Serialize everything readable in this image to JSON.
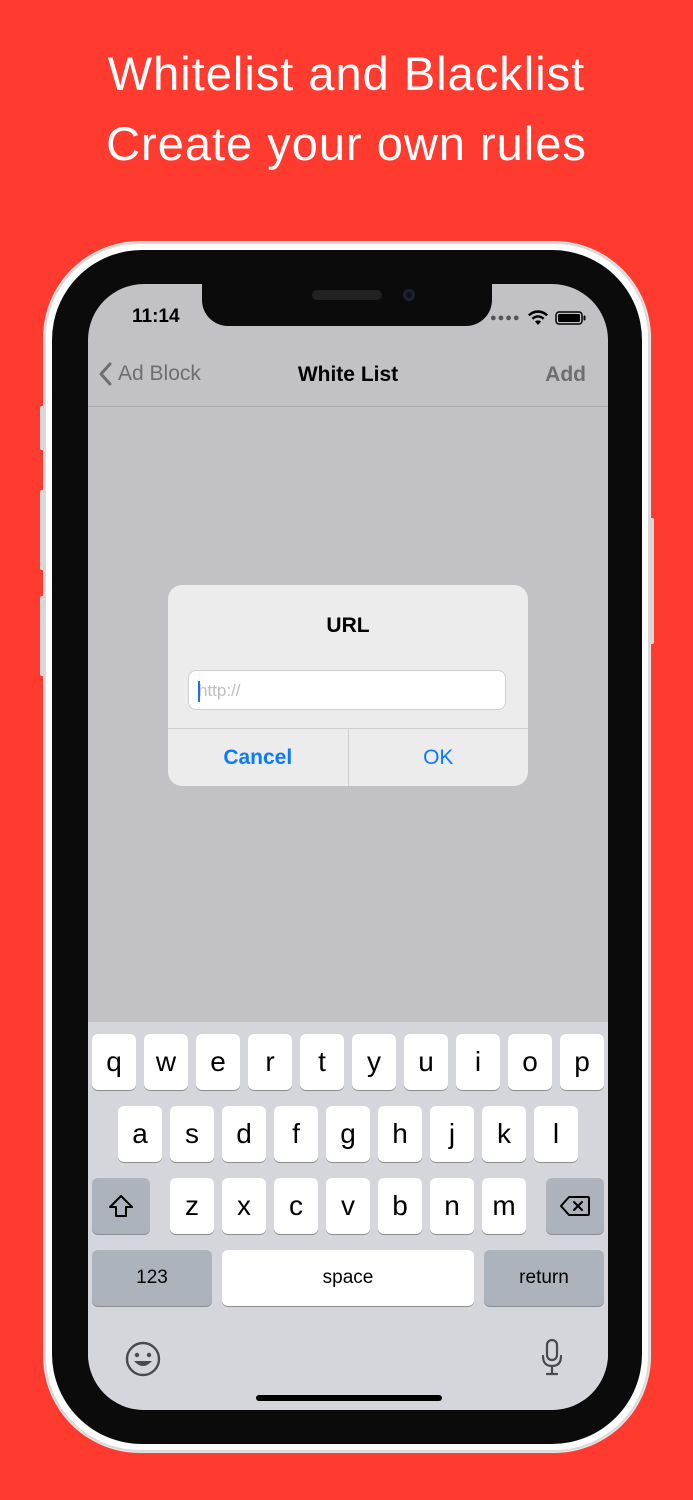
{
  "promo": {
    "line1": "Whitelist and Blacklist",
    "line2": "Create your own rules",
    "background": "#FF3B30"
  },
  "status_bar": {
    "time": "11:14"
  },
  "navbar": {
    "back_label": "Ad Block",
    "title": "White List",
    "add_label": "Add"
  },
  "alert": {
    "title": "URL",
    "input_placeholder": "http://",
    "input_value": "",
    "cancel_label": "Cancel",
    "ok_label": "OK"
  },
  "keyboard": {
    "row1": [
      "q",
      "w",
      "e",
      "r",
      "t",
      "y",
      "u",
      "i",
      "o",
      "p"
    ],
    "row2": [
      "a",
      "s",
      "d",
      "f",
      "g",
      "h",
      "j",
      "k",
      "l"
    ],
    "row3": [
      "z",
      "x",
      "c",
      "v",
      "b",
      "n",
      "m"
    ],
    "numbers_label": "123",
    "space_label": "space",
    "return_label": "return"
  },
  "icons": {
    "back": "chevron-left-icon",
    "signal": "signal-dots-icon",
    "wifi": "wifi-icon",
    "battery": "battery-icon",
    "shift": "shift-icon",
    "delete": "delete-icon",
    "emoji": "emoji-icon",
    "mic": "microphone-icon"
  }
}
